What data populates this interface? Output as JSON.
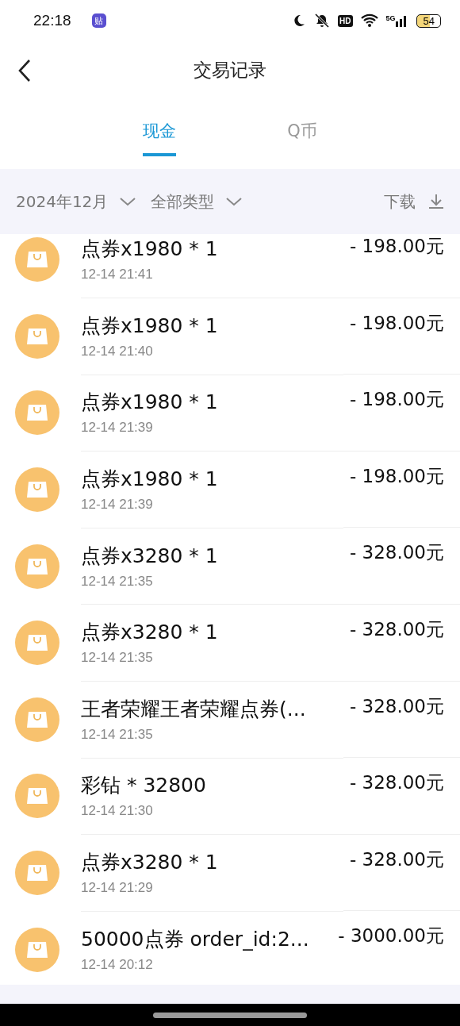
{
  "status_bar": {
    "time": "22:18",
    "app_badge": "贴",
    "hd": "HD",
    "network": "5G",
    "battery": "54"
  },
  "header": {
    "title": "交易记录"
  },
  "tabs": [
    {
      "label": "现金",
      "selected": true
    },
    {
      "label": "Q币",
      "selected": false
    }
  ],
  "filters": {
    "month": "2024年12月",
    "type": "全部类型",
    "download": "下载"
  },
  "transactions": [
    {
      "name": "点券x1980 * 1",
      "time": "12-14 21:41",
      "amount": "- 198.00元"
    },
    {
      "name": "点券x1980 * 1",
      "time": "12-14 21:40",
      "amount": "- 198.00元"
    },
    {
      "name": "点券x1980 * 1",
      "time": "12-14 21:39",
      "amount": "- 198.00元"
    },
    {
      "name": "点券x1980 * 1",
      "time": "12-14 21:39",
      "amount": "- 198.00元"
    },
    {
      "name": "点券x3280 * 1",
      "time": "12-14 21:35",
      "amount": "- 328.00元"
    },
    {
      "name": "点券x3280 * 1",
      "time": "12-14 21:35",
      "amount": "- 328.00元"
    },
    {
      "name": "王者荣耀王者荣耀点券(...",
      "time": "12-14 21:35",
      "amount": "- 328.00元"
    },
    {
      "name": "彩钻 * 32800",
      "time": "12-14 21:30",
      "amount": "- 328.00元"
    },
    {
      "name": "点券x3280 * 1",
      "time": "12-14 21:29",
      "amount": "- 328.00元"
    },
    {
      "name": "50000点券 order_id:2...",
      "time": "12-14 20:12",
      "amount": "- 3000.00元"
    }
  ]
}
